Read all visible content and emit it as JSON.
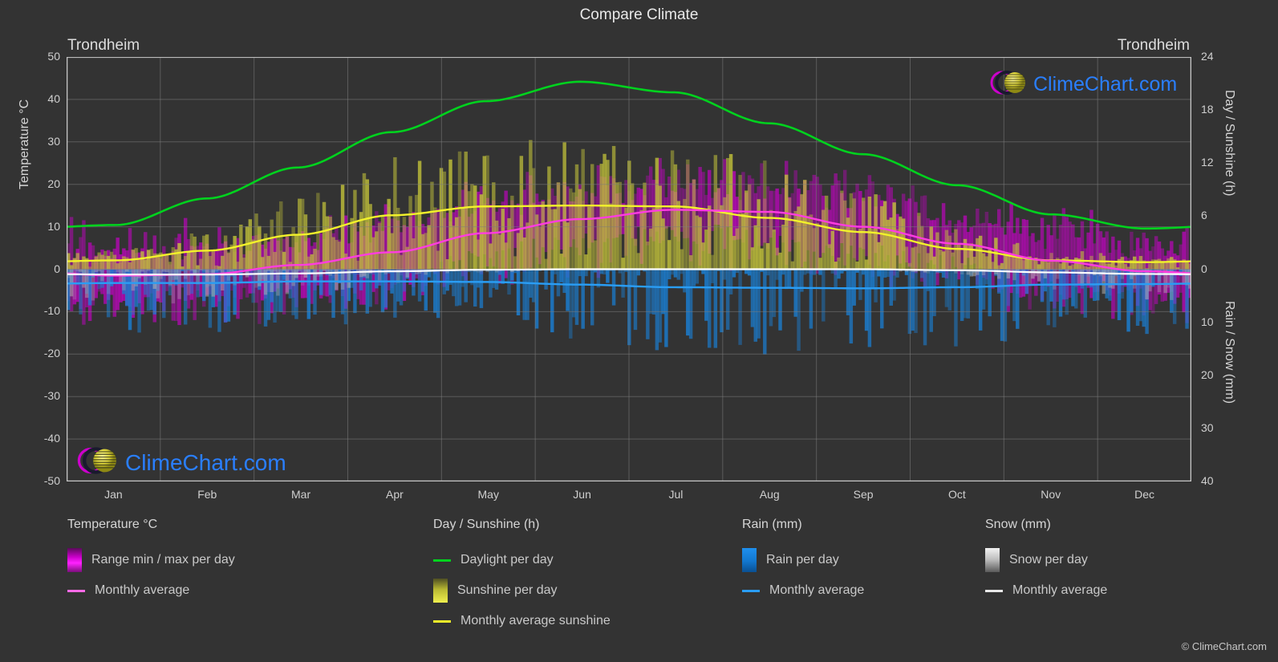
{
  "header": {
    "title": "Compare Climate",
    "city_left": "Trondheim",
    "city_right": "Trondheim"
  },
  "branding": {
    "wordmark": "ClimeChart.com",
    "copyright": "© ClimeChart.com",
    "logo_arc_color": "#cc00cc",
    "logo_sphere_color": "#e8e23c",
    "wordmark_color": "#2a7fff"
  },
  "colors": {
    "background": "#333333",
    "plot_background": "#333333",
    "grid": "#7d7d7d",
    "axis": "#c8c8c8",
    "daylight": "#00d21e",
    "sunshine_avg": "#f2f22a",
    "sunshine_fill": "#c2c23a",
    "temperature_avg": "#ff3ce0",
    "temperature_fill": "#cc00cc",
    "rain_avg": "#2a9df4",
    "rain_fill": "#1a7fd4",
    "snow_avg": "#ffffff",
    "snow_fill": "#b0b0b0",
    "text": "#d0d0d0"
  },
  "axes": {
    "left": {
      "label": "Temperature °C",
      "ticks": [
        "50",
        "40",
        "30",
        "20",
        "10",
        "0",
        "-10",
        "-20",
        "-30",
        "-40",
        "-50"
      ],
      "min": -50,
      "max": 50
    },
    "right_top": {
      "label": "Day / Sunshine (h)",
      "ticks": [
        "24",
        "18",
        "12",
        "6",
        "0"
      ],
      "min": 0,
      "max": 24
    },
    "right_bottom": {
      "label": "Rain / Snow (mm)",
      "ticks": [
        "0",
        "10",
        "20",
        "30",
        "40"
      ],
      "min": 0,
      "max": 40
    },
    "x": {
      "ticks": [
        "Jan",
        "Feb",
        "Mar",
        "Apr",
        "May",
        "Jun",
        "Jul",
        "Aug",
        "Sep",
        "Oct",
        "Nov",
        "Dec"
      ]
    }
  },
  "legend": {
    "groups": [
      {
        "title": "Temperature °C",
        "items": [
          {
            "label": "Range min / max per day",
            "marker": "box",
            "swatch": "sw-temp"
          },
          {
            "label": "Monthly average",
            "marker": "line",
            "color": "#ff6ae6"
          }
        ]
      },
      {
        "title": "Day / Sunshine (h)",
        "items": [
          {
            "label": "Daylight per day",
            "marker": "line",
            "color": "#00d21e"
          },
          {
            "label": "Sunshine per day",
            "marker": "box",
            "swatch": "sw-sun"
          },
          {
            "label": "Monthly average sunshine",
            "marker": "line",
            "color": "#f2f22a"
          }
        ]
      },
      {
        "title": "Rain (mm)",
        "items": [
          {
            "label": "Rain per day",
            "marker": "box",
            "swatch": "sw-rain"
          },
          {
            "label": "Monthly average",
            "marker": "line",
            "color": "#2a9df4"
          }
        ]
      },
      {
        "title": "Snow (mm)",
        "items": [
          {
            "label": "Snow per day",
            "marker": "box",
            "swatch": "sw-snow"
          },
          {
            "label": "Monthly average",
            "marker": "line",
            "color": "#e8e8e8"
          }
        ]
      }
    ]
  },
  "chart_data": {
    "type": "line",
    "title": "Compare Climate",
    "subtitle": "Trondheim",
    "xlabel": "",
    "ylabel": "Temperature °C",
    "ylim": [
      -50,
      50
    ],
    "grid": true,
    "legend_position": "below",
    "categories": [
      "Jan",
      "Feb",
      "Mar",
      "Apr",
      "May",
      "Jun",
      "Jul",
      "Aug",
      "Sep",
      "Oct",
      "Nov",
      "Dec"
    ],
    "series": [
      {
        "name": "Daylight per day",
        "axis": "right_top",
        "unit": "h",
        "color": "#00d21e",
        "values": [
          5.0,
          8.0,
          11.5,
          15.5,
          19.0,
          21.2,
          20.0,
          16.5,
          13.0,
          9.5,
          6.2,
          4.6
        ]
      },
      {
        "name": "Monthly average sunshine",
        "axis": "right_top",
        "unit": "h",
        "color": "#f2f22a",
        "values": [
          1.0,
          2.1,
          3.9,
          6.1,
          7.1,
          7.2,
          7.1,
          5.8,
          4.2,
          2.3,
          1.0,
          0.8
        ]
      },
      {
        "name": "Monthly average temperature",
        "axis": "left",
        "unit": "°C",
        "color": "#ff3ce0",
        "values": [
          -1.5,
          -1.2,
          1.0,
          4.0,
          8.5,
          11.8,
          14.0,
          13.5,
          10.0,
          6.0,
          2.0,
          -0.5
        ]
      },
      {
        "name": "Monthly average rain",
        "axis": "right_bottom",
        "unit": "mm",
        "color": "#2a9df4",
        "values": [
          2.6,
          2.6,
          2.3,
          2.3,
          2.4,
          2.9,
          3.4,
          3.5,
          3.6,
          3.4,
          2.9,
          2.8
        ]
      },
      {
        "name": "Monthly average snow",
        "axis": "right_bottom",
        "unit": "mm",
        "color": "#ffffff",
        "values": [
          1.0,
          1.0,
          0.8,
          0.4,
          0.1,
          0.0,
          0.0,
          0.0,
          0.0,
          0.2,
          0.6,
          0.9
        ]
      }
    ],
    "daily_bands": [
      {
        "name": "Temperature range min / max per day",
        "axis": "left",
        "color": "#cc00cc"
      },
      {
        "name": "Sunshine per day",
        "axis": "right_top",
        "color": "#c2c23a"
      },
      {
        "name": "Rain per day",
        "axis": "right_bottom",
        "color": "#1a7fd4"
      },
      {
        "name": "Snow per day",
        "axis": "right_bottom",
        "color": "#b0b0b0"
      }
    ]
  }
}
